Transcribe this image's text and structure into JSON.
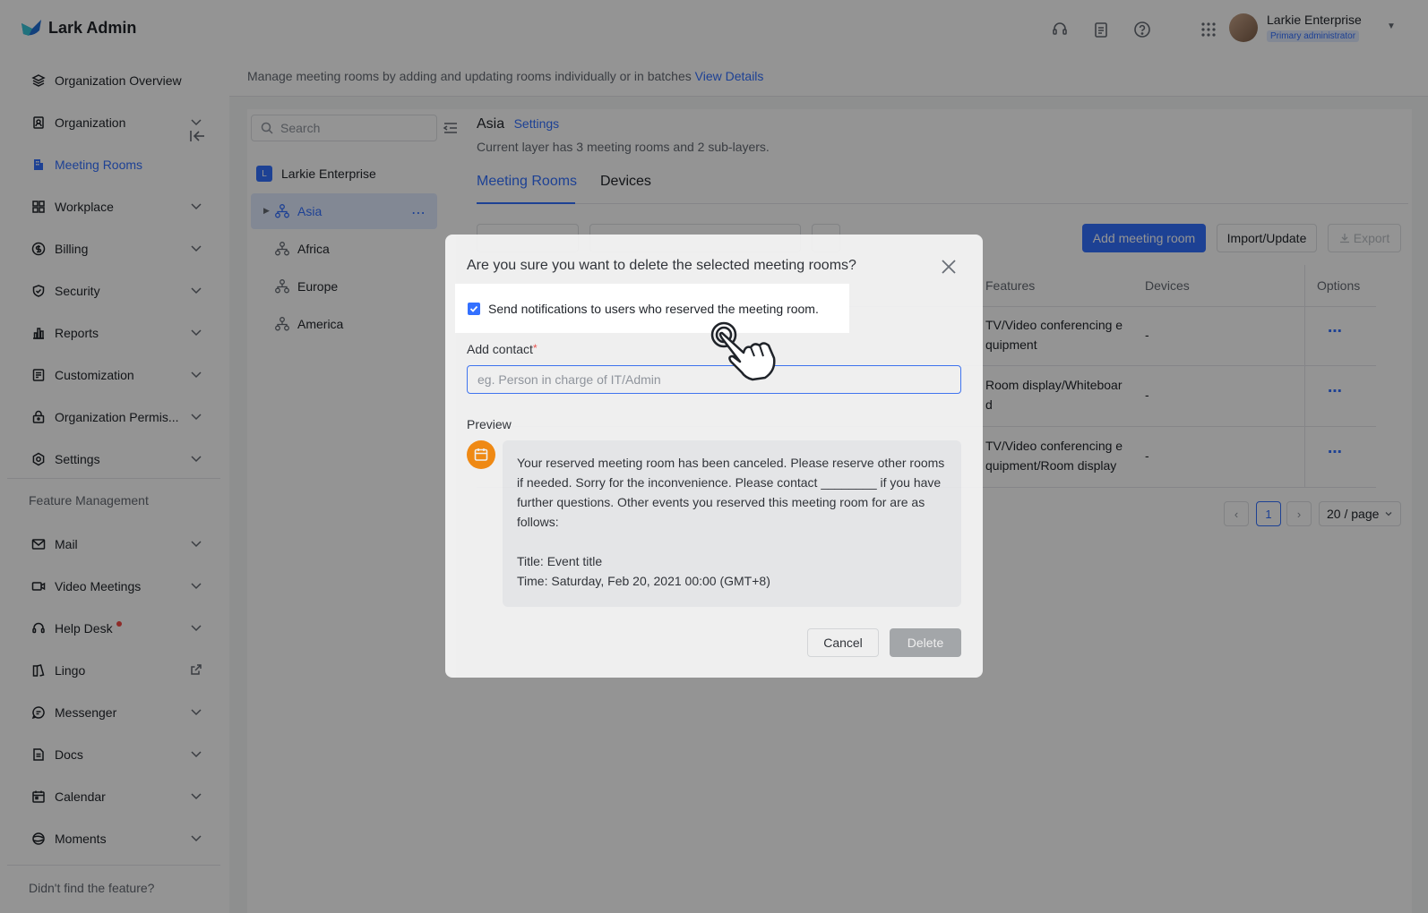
{
  "header": {
    "logo_text": "Lark Admin",
    "user_name": "Larkie Enterprise",
    "user_role": "Primary administrator"
  },
  "sidebar": {
    "items": [
      {
        "label": "Organization Overview",
        "icon": "layers-icon"
      },
      {
        "label": "Organization",
        "icon": "contacts-icon"
      },
      {
        "label": "Meeting Rooms",
        "icon": "building-icon"
      },
      {
        "label": "Workplace",
        "icon": "grid-icon"
      },
      {
        "label": "Billing",
        "icon": "dollar-icon"
      },
      {
        "label": "Security",
        "icon": "shield-icon"
      },
      {
        "label": "Reports",
        "icon": "bar-chart-icon"
      },
      {
        "label": "Customization",
        "icon": "customize-icon"
      },
      {
        "label": "Organization Permis...",
        "icon": "lock-icon"
      },
      {
        "label": "Settings",
        "icon": "gear-icon"
      }
    ],
    "feature_section_label": "Feature Management",
    "feature_items": [
      {
        "label": "Mail",
        "icon": "mail-icon"
      },
      {
        "label": "Video Meetings",
        "icon": "video-icon"
      },
      {
        "label": "Help Desk",
        "icon": "headset-icon"
      },
      {
        "label": "Lingo",
        "icon": "book-icon"
      },
      {
        "label": "Messenger",
        "icon": "chat-icon"
      },
      {
        "label": "Docs",
        "icon": "doc-icon"
      },
      {
        "label": "Calendar",
        "icon": "calendar-icon"
      },
      {
        "label": "Moments",
        "icon": "moments-icon"
      }
    ],
    "footer_text": "Didn't find the feature?"
  },
  "banner": {
    "text": "Manage meeting rooms by adding and updating rooms individually or in batches",
    "link": "View Details"
  },
  "tree": {
    "search_placeholder": "Search",
    "root": {
      "badge": "L",
      "label": "Larkie Enterprise"
    },
    "nodes": [
      "Asia",
      "Africa",
      "Europe",
      "America"
    ]
  },
  "content": {
    "layer_title": "Asia",
    "settings_link": "Settings",
    "layer_desc": "Current layer has 3 meeting rooms and 2 sub-layers.",
    "tabs": [
      "Meeting Rooms",
      "Devices"
    ],
    "add_button": "Add meeting room",
    "import_button": "Import/Update",
    "export_button": "Export",
    "columns": [
      "Features",
      "Devices",
      "Options"
    ],
    "rows": [
      {
        "features": "TV/Video conferencing e quipment",
        "devices": "-"
      },
      {
        "features": "Room display/Whiteboar d",
        "devices": "-"
      },
      {
        "features": "TV/Video conferencing e quipment/Room display",
        "devices": "-"
      }
    ],
    "pagination": {
      "current": "1",
      "page_size": "20 / page"
    }
  },
  "modal": {
    "title": "Are you sure you want to delete the selected meeting rooms?",
    "checkbox_label": "Send notifications to users who reserved the meeting room.",
    "checkbox_checked": true,
    "contact_label": "Add contact",
    "contact_placeholder": "eg. Person in charge of IT/Admin",
    "preview_label": "Preview",
    "preview_message": "Your reserved meeting room has been canceled. Please reserve other rooms if needed. Sorry for the inconvenience. Please contact ________ if you have further questions. Other events you reserved this meeting room for are as follows:",
    "preview_event_title": "Title: Event title",
    "preview_event_time": "Time: Saturday, Feb 20, 2021 00:00 (GMT+8)",
    "cancel_button": "Cancel",
    "delete_button": "Delete"
  },
  "colors": {
    "accent": "#3370ff",
    "danger_dot": "#f54a45",
    "bot_avatar": "#ff8800"
  }
}
